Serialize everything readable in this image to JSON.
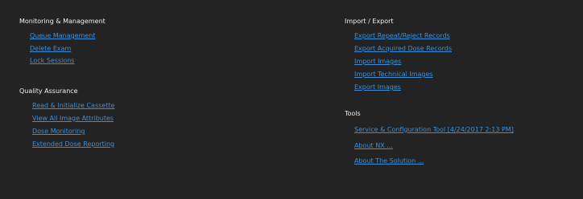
{
  "sections": {
    "monitoring": {
      "title": "Monitoring & Management",
      "items": [
        "Queue Management",
        "Delete Exam",
        "Lock Sessions"
      ]
    },
    "quality": {
      "title": "Quality Assurance",
      "items": [
        "Read & Initialize Cassette",
        "View All Image Attributes",
        "Dose Monitoring",
        "Extended Dose Reporting"
      ]
    },
    "import_export": {
      "title": "Import / Export",
      "items": [
        "Export Repeat/Reject Records",
        "Export Acquired Dose Records",
        "Import Images",
        "Import Technical Images",
        "Export Images"
      ]
    },
    "tools": {
      "title": "Tools",
      "items": [
        "Service & Configuration Tool  [4/24/2017 2:13 PM]",
        "About NX ...",
        "About The Solution ..."
      ]
    }
  },
  "colors": {
    "background": "#232323",
    "heading": "#f0f0f0",
    "link": "#3f8fd6"
  }
}
